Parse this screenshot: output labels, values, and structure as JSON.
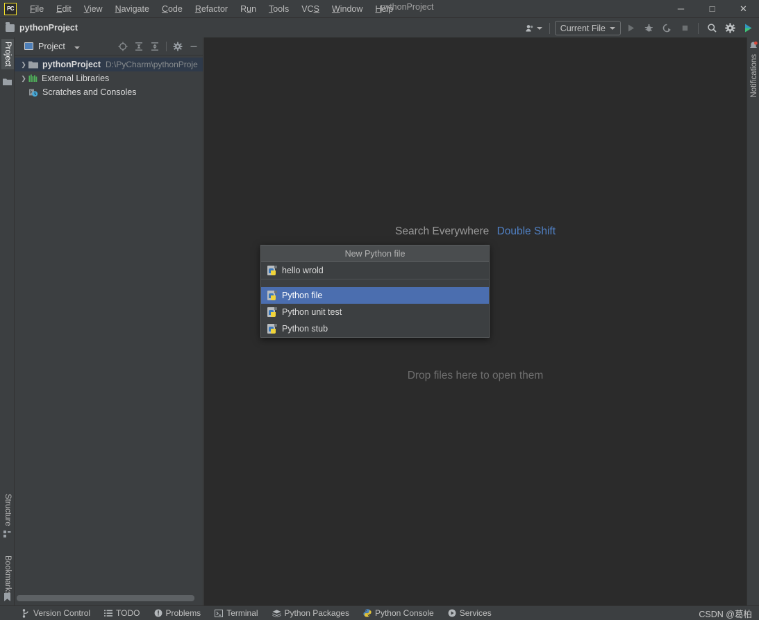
{
  "window": {
    "logo_text": "PC",
    "title": "pythonProject",
    "controls": [
      {
        "name": "minimize",
        "glyph": "─"
      },
      {
        "name": "maximize",
        "glyph": "□"
      },
      {
        "name": "close",
        "glyph": "✕"
      }
    ]
  },
  "menubar": {
    "items": [
      {
        "label": "File",
        "mnemonic": 0
      },
      {
        "label": "Edit",
        "mnemonic": 0
      },
      {
        "label": "View",
        "mnemonic": 0
      },
      {
        "label": "Navigate",
        "mnemonic": 0
      },
      {
        "label": "Code",
        "mnemonic": 0
      },
      {
        "label": "Refactor",
        "mnemonic": 0
      },
      {
        "label": "Run",
        "mnemonic": 1
      },
      {
        "label": "Tools",
        "mnemonic": 0
      },
      {
        "label": "VCS",
        "mnemonic": 2
      },
      {
        "label": "Window",
        "mnemonic": 0
      },
      {
        "label": "Help",
        "mnemonic": 0
      }
    ]
  },
  "navbar": {
    "breadcrumb": "pythonProject",
    "run_config": "Current File",
    "icons": [
      {
        "name": "user-accounts-icon"
      },
      {
        "name": "run-icon"
      },
      {
        "name": "debug-icon"
      },
      {
        "name": "run-coverage-icon"
      },
      {
        "name": "stop-icon"
      },
      {
        "name": "search-icon"
      },
      {
        "name": "settings-gear-icon"
      },
      {
        "name": "ide-services-icon"
      }
    ]
  },
  "left_stripe": {
    "top": [
      {
        "label": "Project",
        "active": true
      }
    ],
    "bottom": [
      {
        "label": "Structure"
      },
      {
        "label": "Bookmarks"
      }
    ]
  },
  "right_stripe": {
    "items": [
      {
        "label": "Notifications"
      }
    ]
  },
  "project_panel": {
    "title": "Project",
    "toolbar_icons": [
      {
        "name": "select-opened-file-icon"
      },
      {
        "name": "expand-all-icon"
      },
      {
        "name": "collapse-all-icon"
      },
      {
        "name": "panel-settings-gear-icon"
      },
      {
        "name": "hide-panel-icon"
      }
    ],
    "tree": [
      {
        "label": "pythonProject",
        "path": "D:\\PyCharm\\pythonProje",
        "icon": "folder-icon",
        "expandable": true,
        "selected": true,
        "bold": true,
        "indent": 0
      },
      {
        "label": "External Libraries",
        "path": "",
        "icon": "libraries-icon",
        "expandable": true,
        "selected": false,
        "bold": false,
        "indent": 0
      },
      {
        "label": "Scratches and Consoles",
        "path": "",
        "icon": "scratches-icon",
        "expandable": false,
        "selected": false,
        "bold": false,
        "indent": 0
      }
    ]
  },
  "editor": {
    "search_hint_label": "Search Everywhere",
    "search_hint_shortcut": "Double Shift",
    "drop_hint": "Drop files here to open them"
  },
  "popup": {
    "title": "New Python file",
    "items_top": [
      {
        "label": "hello wrold",
        "icon": "python-file-icon",
        "selected": false
      }
    ],
    "items_bottom": [
      {
        "label": "Python file",
        "icon": "python-file-icon",
        "selected": true
      },
      {
        "label": "Python unit test",
        "icon": "python-file-icon",
        "selected": false
      },
      {
        "label": "Python stub",
        "icon": "python-file-icon",
        "selected": false
      }
    ]
  },
  "statusbar": {
    "items": [
      {
        "label": "Version Control",
        "icon": "branch-icon"
      },
      {
        "label": "TODO",
        "icon": "list-icon"
      },
      {
        "label": "Problems",
        "icon": "warning-circle-icon"
      },
      {
        "label": "Terminal",
        "icon": "terminal-icon"
      },
      {
        "label": "Python Packages",
        "icon": "packages-icon"
      },
      {
        "label": "Python Console",
        "icon": "python-icon"
      },
      {
        "label": "Services",
        "icon": "play-circle-icon"
      }
    ],
    "watermark": "CSDN @葛柏"
  },
  "colors": {
    "accent_blue": "#4b6eaf",
    "hint_blue": "#5080c4",
    "panel_bg": "#3c3f41",
    "editor_bg": "#2b2b2b",
    "selected_row": "#2f3a4a"
  }
}
